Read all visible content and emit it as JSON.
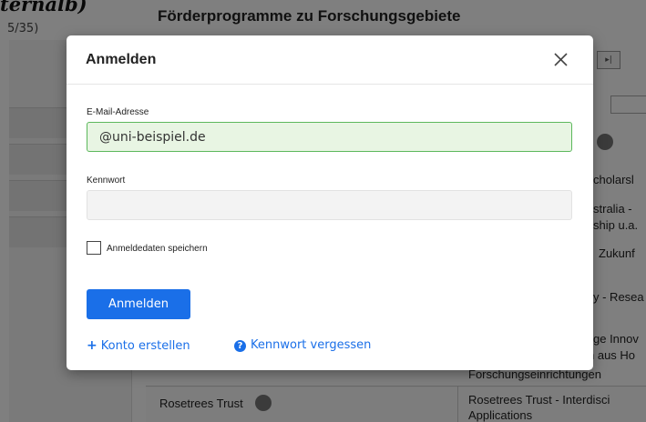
{
  "background": {
    "corner_title": "ternalb)",
    "count": "5/35)",
    "heading": "Förderprogramme zu Forschungsgebiete",
    "row_texts": [
      "cholarsl",
      "stralia -",
      "ship u.a.",
      "Zukunf",
      "y - Resea",
      "ge Innov",
      "n aus Ho",
      "Forschungseinrichtungen",
      "Rosetrees Trust - Interdisci",
      "Applications"
    ],
    "footer_left": "Rosetrees Trust"
  },
  "modal": {
    "title": "Anmelden",
    "email_label": "E-Mail-Adresse",
    "email_value": "@uni-beispiel.de",
    "password_label": "Kennwort",
    "password_value": "",
    "remember_label": "Anmeldedaten speichern",
    "submit_label": "Anmelden",
    "create_account_label": "Konto erstellen",
    "forgot_password_label": "Kennwort vergessen"
  },
  "colors": {
    "primary": "#1a6fe8",
    "email_valid_border": "#5cb85c",
    "email_valid_bg": "#e8f5e3",
    "overlay": "rgba(0,0,0,0.5)"
  },
  "icons": {
    "close": "close-icon",
    "create_account": "plus-icon",
    "forgot_password": "question-circle-icon"
  }
}
